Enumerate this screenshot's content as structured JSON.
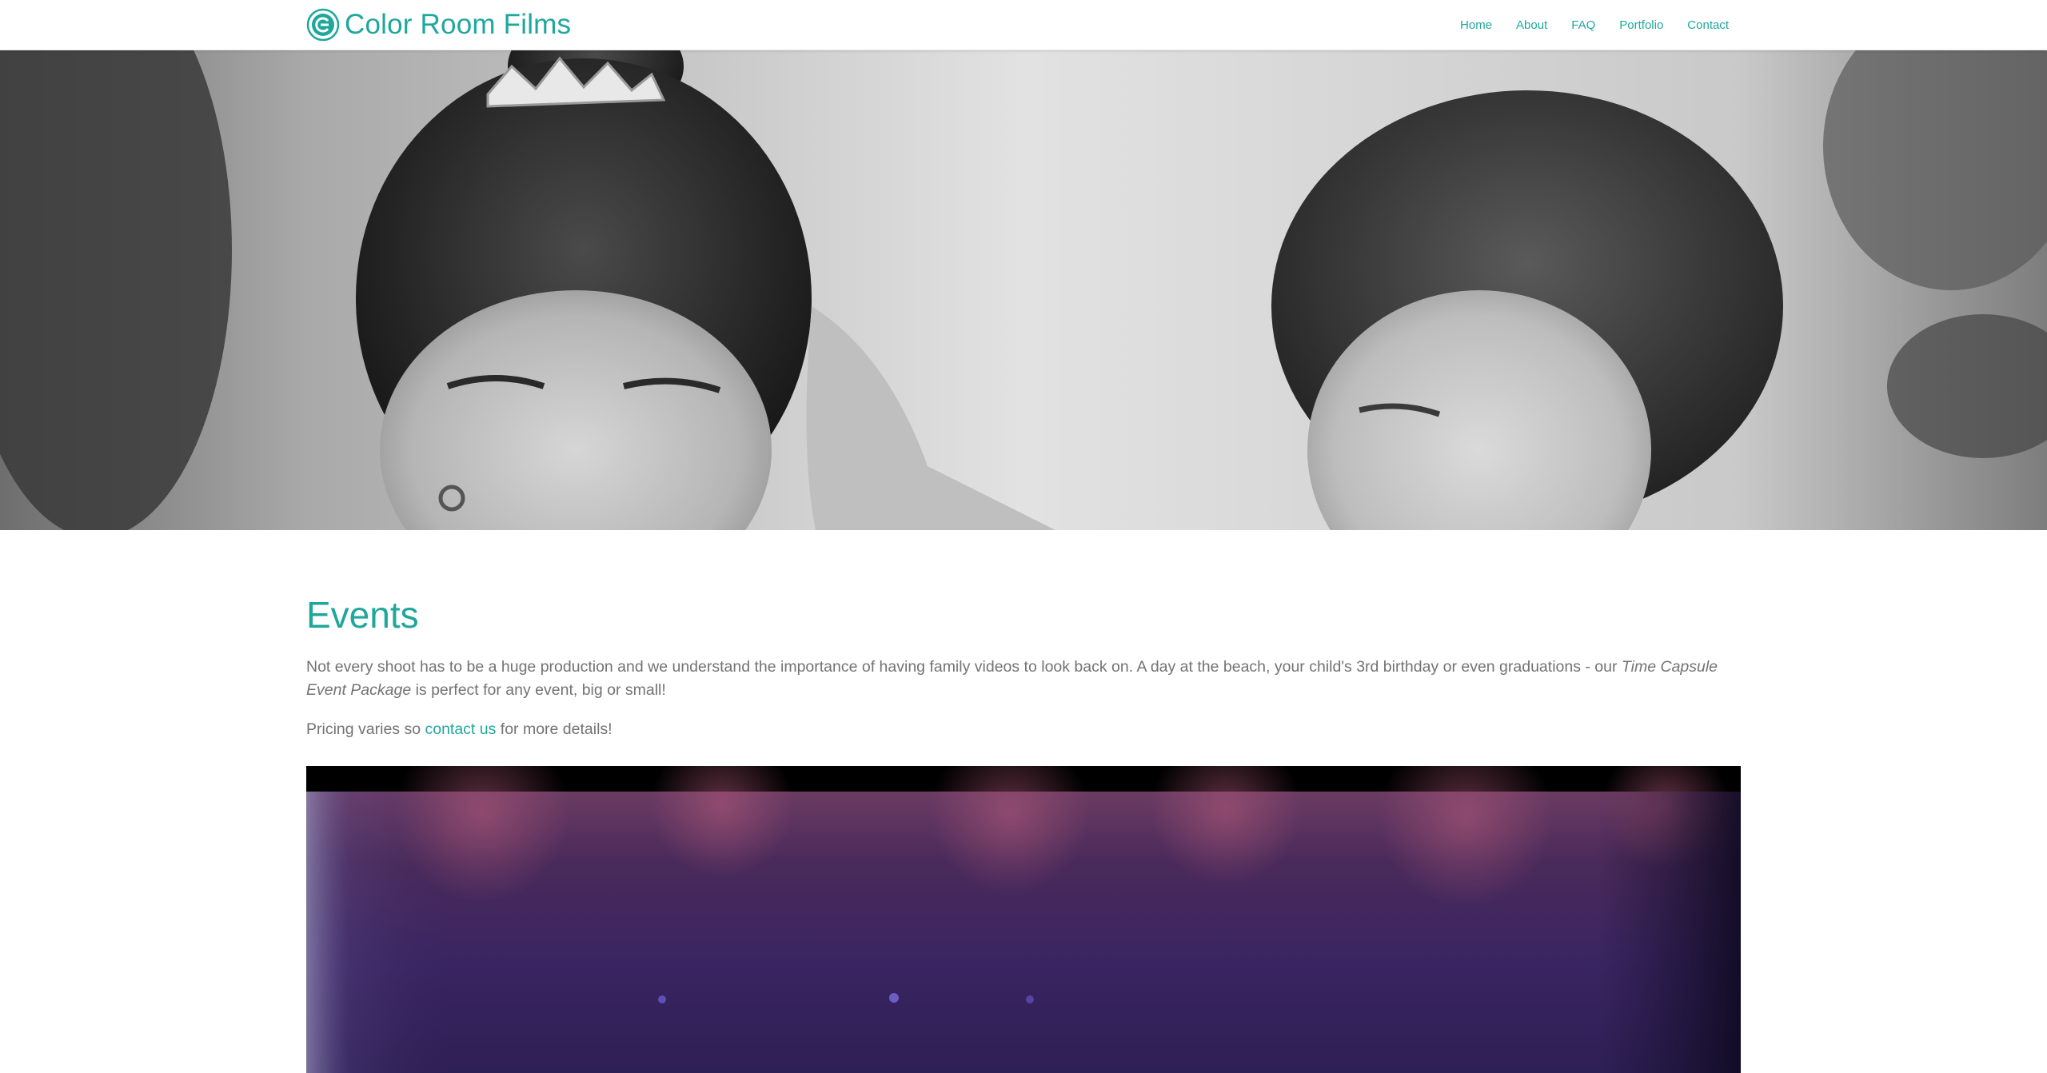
{
  "header": {
    "brand_name": "Color Room Films",
    "nav": [
      {
        "label": "Home"
      },
      {
        "label": "About"
      },
      {
        "label": "FAQ"
      },
      {
        "label": "Portfolio"
      },
      {
        "label": "Contact"
      }
    ]
  },
  "main": {
    "title": "Events",
    "paragraph": {
      "text_before": "Not every shoot has to be a huge production and we understand the importance of having family videos to look back on. A day at the beach, your child's 3rd birthday or even graduations - our ",
      "emphasis": "Time Capsule Event Package",
      "text_after": " is perfect for any event, big or small!"
    },
    "pricing": {
      "before": "Pricing varies so ",
      "link": "contact us",
      "after": " for more details!"
    }
  },
  "colors": {
    "accent": "#1fa79c",
    "body_text": "#737373"
  },
  "icons": {
    "brand_logo": "color-room-films-logo-icon"
  }
}
